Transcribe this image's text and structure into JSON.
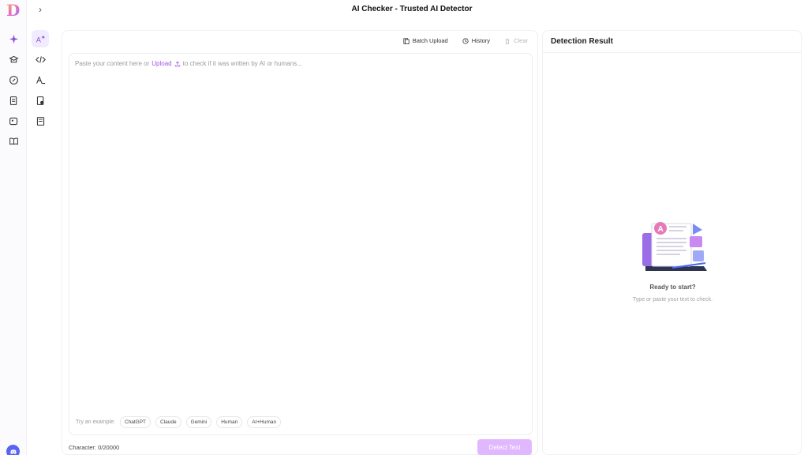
{
  "app": {
    "logo_letter": "D",
    "page_title": "AI Checker - Trusted AI Detector"
  },
  "sidebar": {
    "icons": [
      "sparkle-icon",
      "hat-icon",
      "pencil-icon",
      "doc-scan-icon",
      "image-edit-icon",
      "book-icon"
    ],
    "icons2": [
      "ai-text-icon",
      "code-icon",
      "font-icon",
      "doc-audio-icon",
      "notebook-icon"
    ]
  },
  "toolbar": {
    "batch_upload": "Batch Upload",
    "history": "History",
    "clear": "Clear"
  },
  "editor": {
    "placeholder_before": "Paste your content here or",
    "upload_link": "Upload",
    "placeholder_after": "to check if it was written by AI or humans...",
    "try_label": "Try an example:",
    "examples": [
      "ChatGPT",
      "Claude",
      "Gemini",
      "Human",
      "AI+Human"
    ],
    "character_count": "Character: 0/20000",
    "detect_button": "Detect Text"
  },
  "result": {
    "title": "Detection Result",
    "ready": "Ready to start?",
    "hint": "Type or paste your text to check."
  },
  "colors": {
    "accent": "#a055e6",
    "button_bg": "#e1b8ff",
    "discord": "#5865f2"
  }
}
